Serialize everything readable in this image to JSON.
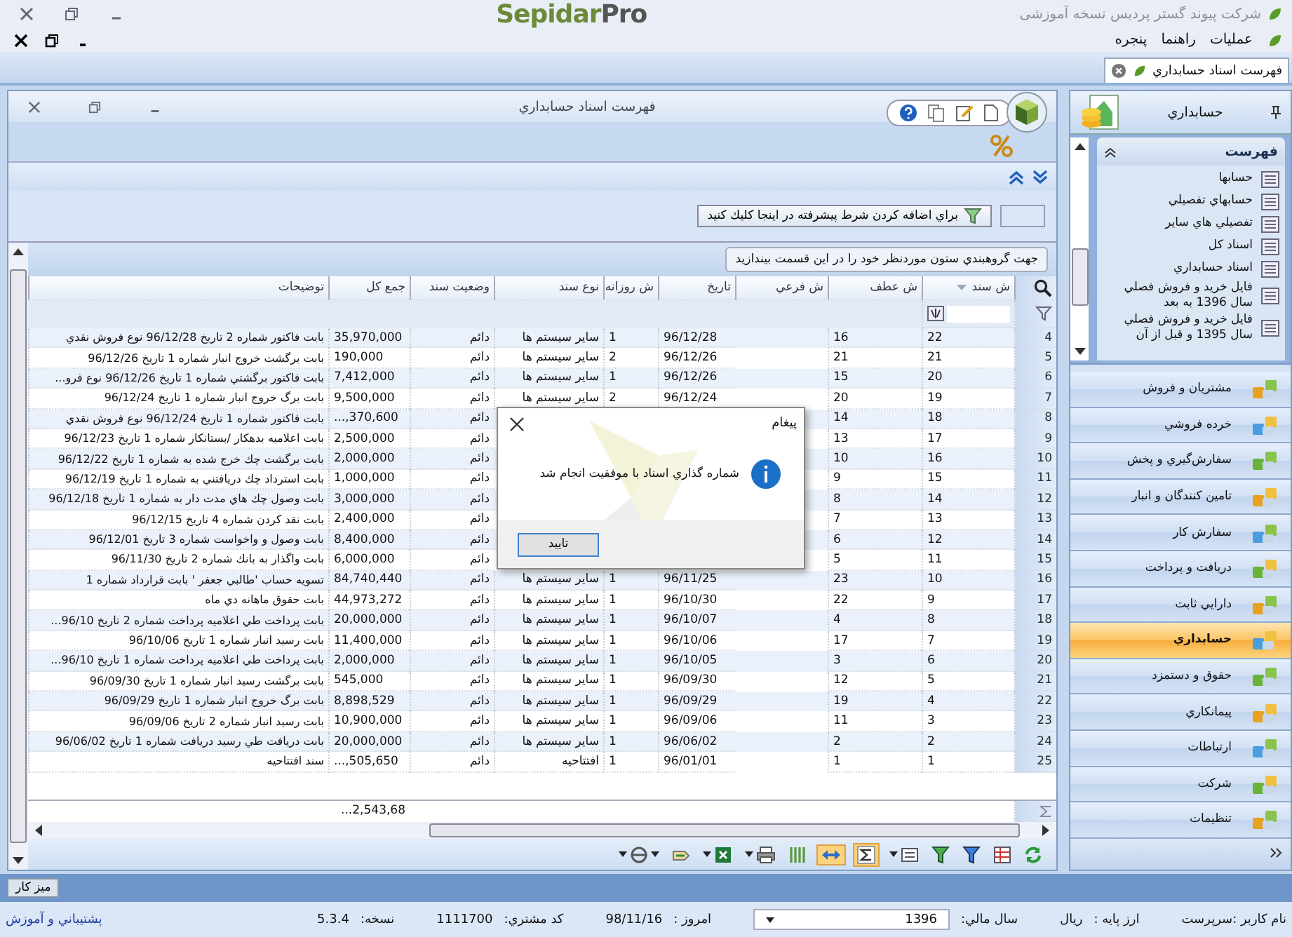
{
  "app_title": "شرکت پیوند گستر پردیس نسخه آموزشی",
  "logo": {
    "first": "Sepidar",
    "second": "Pro"
  },
  "menu": [
    "عمليات",
    "راهنما",
    "پنجره"
  ],
  "doc_tabs": [
    {
      "label": "فهرست اسناد حسابداري",
      "selected": true
    }
  ],
  "document": {
    "title": "فهرست اسناد حسابداري",
    "advanced_filter": "براي اضافه كردن شرط پيشرفته در اينجا كليك كنيد",
    "group_hint": "جهت گروهبندي ستون موردنظر خود را در اين قسمت بيندازيد",
    "columns": [
      "ش سند",
      "ش عطف",
      "ش فرعي",
      "تاريخ",
      "ش روزانه",
      "نوع سند",
      "وضعيت سند",
      "جمع كل",
      "توضيحات"
    ],
    "rows": [
      {
        "num": "4",
        "doc": "22",
        "ref": "16",
        "date": "96/12/28",
        "daily": "1",
        "type": "ساير سيستم ها",
        "status": "دائم",
        "total": "35,970,000",
        "desc": "بابت فاكتور شماره 2 تاريخ 96/12/28 نوع فروش نقدي"
      },
      {
        "num": "5",
        "doc": "21",
        "ref": "21",
        "date": "96/12/26",
        "daily": "2",
        "type": "ساير سيستم ها",
        "status": "دائم",
        "total": "190,000",
        "desc": "بابت برگشت خروج انبار شماره 1 تاريخ 96/12/26"
      },
      {
        "num": "6",
        "doc": "20",
        "ref": "15",
        "date": "96/12/26",
        "daily": "1",
        "type": "ساير سيستم ها",
        "status": "دائم",
        "total": "7,412,000",
        "desc": "بابت  فاكتور برگشتي شماره 1 تاريخ 96/12/26 نوع فرو..."
      },
      {
        "num": "7",
        "doc": "19",
        "ref": "20",
        "date": "96/12/24",
        "daily": "2",
        "type": "ساير سيستم ها",
        "status": "دائم",
        "total": "9,500,000",
        "desc": "بابت برگ خروج انبار شماره 1 تاريخ 96/12/24"
      },
      {
        "num": "8",
        "doc": "18",
        "ref": "14",
        "status": "دائم",
        "total": "...,370,600",
        "desc": "بابت فاكتور شماره 1 تاريخ 96/12/24 نوع فروش نقدي"
      },
      {
        "num": "9",
        "doc": "17",
        "ref": "13",
        "status": "دائم",
        "total": "2,500,000",
        "desc": "بابت اعلاميه بدهكار /بستانكار شماره 1 تاريخ 96/12/23"
      },
      {
        "num": "10",
        "doc": "16",
        "ref": "10",
        "status": "دائم",
        "total": "2,000,000",
        "desc": "بابت برگشت چك خرج شده به شماره 1 تاريخ 96/12/22"
      },
      {
        "num": "11",
        "doc": "15",
        "ref": "9",
        "status": "دائم",
        "total": "1,000,000",
        "desc": "بابت استرداد چك دريافتني به شماره 1 تاريخ 96/12/19"
      },
      {
        "num": "12",
        "doc": "14",
        "ref": "8",
        "status": "دائم",
        "total": "3,000,000",
        "desc": "بابت وصول چك هاي مدت دار به شماره 1 تاريخ 96/12/18"
      },
      {
        "num": "13",
        "doc": "13",
        "ref": "7",
        "status": "دائم",
        "total": "2,400,000",
        "desc": "بابت نقد كردن شماره 4 تاريخ 96/12/15"
      },
      {
        "num": "14",
        "doc": "12",
        "ref": "6",
        "status": "دائم",
        "total": "8,400,000",
        "desc": "بابت وصول و واخواست شماره 3 تاريخ 96/12/01"
      },
      {
        "num": "15",
        "doc": "11",
        "ref": "5",
        "status": "دائم",
        "total": "6,000,000",
        "desc": "بابت واگذار به بانك شماره 2 تاريخ 96/11/30"
      },
      {
        "num": "16",
        "doc": "10",
        "ref": "23",
        "date": "96/11/25",
        "daily": "1",
        "type": "ساير سيستم ها",
        "status": "دائم",
        "total": "84,740,440",
        "desc": "تسويه حساب 'طالبي جعفر ' بابت قرارداد شماره 1"
      },
      {
        "num": "17",
        "doc": "9",
        "ref": "22",
        "date": "96/10/30",
        "daily": "1",
        "type": "ساير سيستم ها",
        "status": "دائم",
        "total": "44,973,272",
        "desc": "بابت حقوق ماهانه دي ماه"
      },
      {
        "num": "18",
        "doc": "8",
        "ref": "4",
        "date": "96/10/07",
        "daily": "1",
        "type": "ساير سيستم ها",
        "status": "دائم",
        "total": "20,000,000",
        "desc": "بابت پرداخت طي اعلاميه پرداخت شماره 2 تاريخ 96/10..."
      },
      {
        "num": "19",
        "doc": "7",
        "ref": "17",
        "date": "96/10/06",
        "daily": "1",
        "type": "ساير سيستم ها",
        "status": "دائم",
        "total": "11,400,000",
        "desc": "بابت رسيد انبار شماره 1 تاريخ 96/10/06"
      },
      {
        "num": "20",
        "doc": "6",
        "ref": "3",
        "date": "96/10/05",
        "daily": "1",
        "type": "ساير سيستم ها",
        "status": "دائم",
        "total": "2,000,000",
        "desc": "بابت پرداخت طي اعلاميه پرداخت شماره 1 تاريخ 96/10..."
      },
      {
        "num": "21",
        "doc": "5",
        "ref": "12",
        "date": "96/09/30",
        "daily": "1",
        "type": "ساير سيستم ها",
        "status": "دائم",
        "total": "545,000",
        "desc": "بابت برگشت رسيد انبار شماره 1 تاريخ 96/09/30"
      },
      {
        "num": "22",
        "doc": "4",
        "ref": "19",
        "date": "96/09/29",
        "daily": "1",
        "type": "ساير سيستم ها",
        "status": "دائم",
        "total": "8,898,529",
        "desc": "بابت برگ خروج انبار شماره 1 تاريخ 96/09/29"
      },
      {
        "num": "23",
        "doc": "3",
        "ref": "11",
        "date": "96/09/06",
        "daily": "1",
        "type": "ساير سيستم ها",
        "status": "دائم",
        "total": "10,900,000",
        "desc": "بابت رسيد انبار شماره 2 تاريخ 96/09/06"
      },
      {
        "num": "24",
        "doc": "2",
        "ref": "2",
        "date": "96/06/02",
        "daily": "1",
        "type": "ساير سيستم ها",
        "status": "دائم",
        "total": "20,000,000",
        "desc": "بابت دريافت طي رسيد دريافت شماره 1 تاريخ 96/06/02"
      },
      {
        "num": "25",
        "doc": "1",
        "ref": "1",
        "date": "96/01/01",
        "daily": "1",
        "type": "افتتاحيه",
        "status": "دائم",
        "total": "...,505,650",
        "desc": "سند افتتاحيه"
      }
    ],
    "sum_total": "...2,543,68",
    "toolbar": [
      {
        "kind": "refresh",
        "on": false
      },
      {
        "kind": "layout",
        "on": false
      },
      {
        "kind": "filter",
        "on": false
      },
      {
        "kind": "filter-green",
        "on": false
      },
      {
        "kind": "group",
        "on": false
      },
      {
        "kind": "sum",
        "on": true
      },
      {
        "kind": "fit",
        "on": true
      },
      {
        "kind": "columns",
        "on": false
      },
      {
        "kind": "print",
        "on": false
      },
      {
        "kind": "excel",
        "on": false
      },
      {
        "kind": "export",
        "on": false
      },
      {
        "kind": "clear",
        "on": false
      }
    ]
  },
  "dialog": {
    "title": "پيغام",
    "message": "شماره گذاري اسناد با موفقيت انجام شد",
    "button": "تاييد"
  },
  "sidebar": {
    "title": "حسابداري",
    "list_title": "فهرست",
    "list_items": [
      "حسابها",
      "حسابهاي تفصيلي",
      "تفصيلي هاي ساير",
      "اسناد كل",
      "اسناد حسابداري",
      "فايل خريد و فروش فصلي سال 1396 به بعد",
      "فايل خريد و فروش فصلي سال 1395 و قبل از آن"
    ],
    "modules": [
      {
        "label": "مشتريان و فروش",
        "selected": false
      },
      {
        "label": "خرده فروشي",
        "selected": false
      },
      {
        "label": "سفارش‌گيري و پخش",
        "selected": false
      },
      {
        "label": "تامين كنندگان و انبار",
        "selected": false
      },
      {
        "label": "سفارش كار",
        "selected": false
      },
      {
        "label": "دريافت و پرداخت",
        "selected": false
      },
      {
        "label": "دارايي ثابت",
        "selected": false
      },
      {
        "label": "حسابداري",
        "selected": true
      },
      {
        "label": "حقوق و دستمزد",
        "selected": false
      },
      {
        "label": "پيمانكاري",
        "selected": false
      },
      {
        "label": "ارتباطات",
        "selected": false
      },
      {
        "label": "شركت",
        "selected": false
      },
      {
        "label": "تنظيمات",
        "selected": false
      }
    ]
  },
  "workspace_button": "میز کار",
  "status_bar": {
    "user": "نام کاربر :سرپرست",
    "fields": [
      {
        "kind": "text",
        "label": "ارز پايه :",
        "value": "ريال"
      },
      {
        "kind": "select",
        "label": "سال مالي:",
        "value": "1396"
      },
      {
        "kind": "text",
        "label": "امروز :",
        "value": "98/11/16"
      },
      {
        "kind": "text",
        "label": "كد مشتري:",
        "value": "1111700"
      },
      {
        "kind": "text",
        "label": "نسخه:",
        "value": "5.3.4"
      }
    ],
    "support_link": "پشتيباني و آموزش"
  }
}
